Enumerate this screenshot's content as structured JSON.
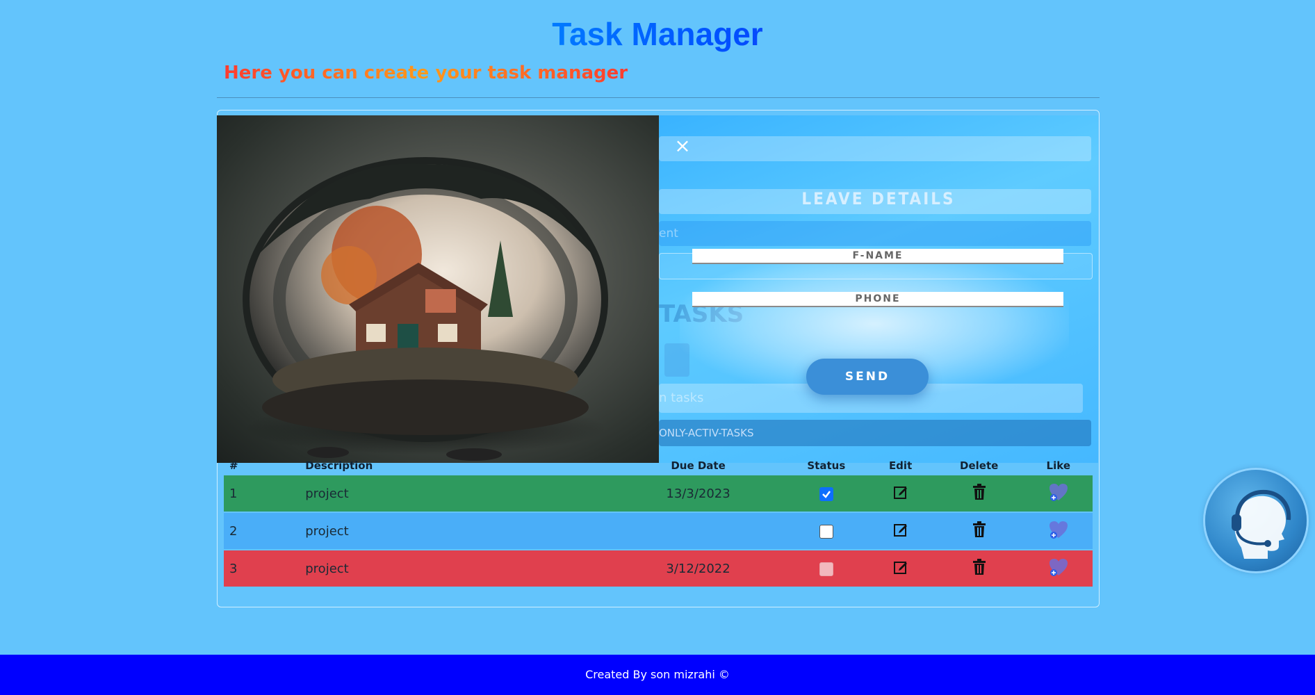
{
  "header": {
    "title_part1": "Task",
    "title_part2": "Manager",
    "subtitle": "Here you can create your task manager"
  },
  "modal": {
    "close_icon": "×",
    "title": "LEAVE DETAILS",
    "fname_placeholder": "F-NAME",
    "phone_placeholder": "PHONE",
    "send_label": "SEND",
    "image_icon": "house-in-glass-sphere-image"
  },
  "background": {
    "tasks_heading_fragment": "TASKS",
    "search_fragment": "n tasks",
    "filter_fragment": "ONLY-ACTIV-TASKS",
    "field_fragment": "ent"
  },
  "table": {
    "headers": [
      "#",
      "Description",
      "Due Date",
      "Status",
      "Edit",
      "Delete",
      "Like"
    ],
    "rows": [
      {
        "num": "1",
        "description": "project",
        "due": "13/3/2023",
        "status": "checked",
        "color": "#2e9a5e"
      },
      {
        "num": "2",
        "description": "project",
        "due": "",
        "status": "unchecked",
        "color": "#4aaef8"
      },
      {
        "num": "3",
        "description": "project",
        "due": "3/12/2022",
        "status": "faded",
        "color": "#e0404e"
      }
    ]
  },
  "footer": {
    "text": "Created By son mizrahi ©"
  },
  "colors": {
    "background": "#63c4fc",
    "footer": "#0000ff",
    "accent": "#3b8fd8"
  }
}
